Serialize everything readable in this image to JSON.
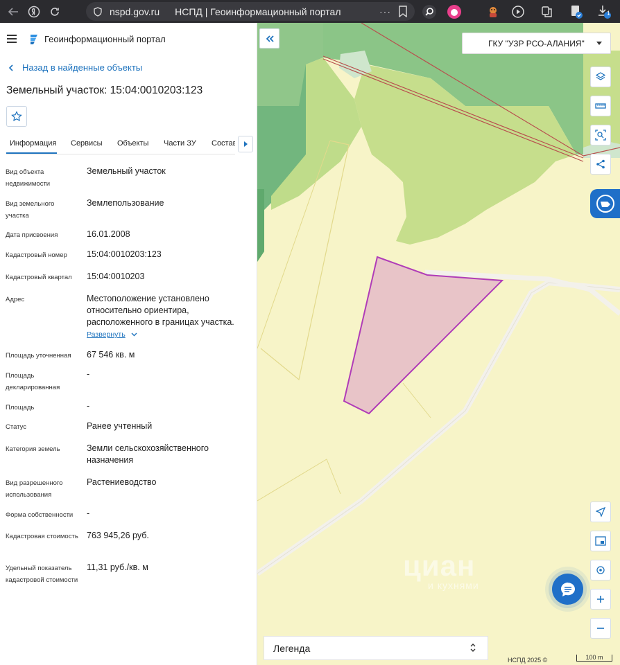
{
  "browser": {
    "domain": "nspd.gov.ru",
    "tab_title": "НСПД | Геоинформационный портал",
    "dots": "···",
    "download_badge": "1"
  },
  "panel": {
    "portal_title": "Геоинформационный портал",
    "back_link": "Назад в найденные объекты",
    "object_title": "Земельный участок: 15:04:0010203:123",
    "tabs": [
      {
        "label": "Информация"
      },
      {
        "label": "Сервисы"
      },
      {
        "label": "Объекты"
      },
      {
        "label": "Части ЗУ"
      },
      {
        "label": "Состав"
      }
    ],
    "expand_label": "Развернуть",
    "rows": [
      {
        "label": "Вид объекта недвижимости",
        "value": "Земельный участок"
      },
      {
        "label": "Вид земельного участка",
        "value": "Землепользование"
      },
      {
        "label": "Дата присвоения",
        "value": "16.01.2008"
      },
      {
        "label": "Кадастровый номер",
        "value": "15:04:0010203:123"
      },
      {
        "label": "Кадастровый квартал",
        "value": "15:04:0010203"
      },
      {
        "label": "Адрес",
        "value": "Местоположение установлено относительно ориентира, расположенного в границах участка."
      },
      {
        "label": "Площадь уточненная",
        "value": "67 546 кв. м"
      },
      {
        "label": "Площадь декларированная",
        "value": "-"
      },
      {
        "label": "Площадь",
        "value": "-"
      },
      {
        "label": "Статус",
        "value": "Ранее учтенный"
      },
      {
        "label": "Категория земель",
        "value": "Земли сельскохозяйственного назначения"
      },
      {
        "label": "Вид разрешенного использования",
        "value": "Растениеводство"
      },
      {
        "label": "Форма собственности",
        "value": "-"
      },
      {
        "label": "Кадастровая стоимость",
        "value": "763 945,26 руб."
      },
      {
        "label": "Удельный показатель кадастровой стоимости",
        "value": "11,31 руб./кв. м"
      }
    ]
  },
  "map": {
    "org_select": "ГКУ \"УЗР РСО-АЛАНИЯ\"",
    "legend_label": "Легенда",
    "attribution": "НСПД 2025 ©",
    "scale_label": "100 m",
    "watermark": "циан",
    "watermark_sub": "и кухнями",
    "colors": {
      "field": "#f7f4c8",
      "forest": "#c6de8c",
      "dense_forest": "#6fb47a",
      "parcel_fill": "#e8c4c8",
      "parcel_stroke": "#b03cb8",
      "accent": "#1e73be"
    }
  }
}
